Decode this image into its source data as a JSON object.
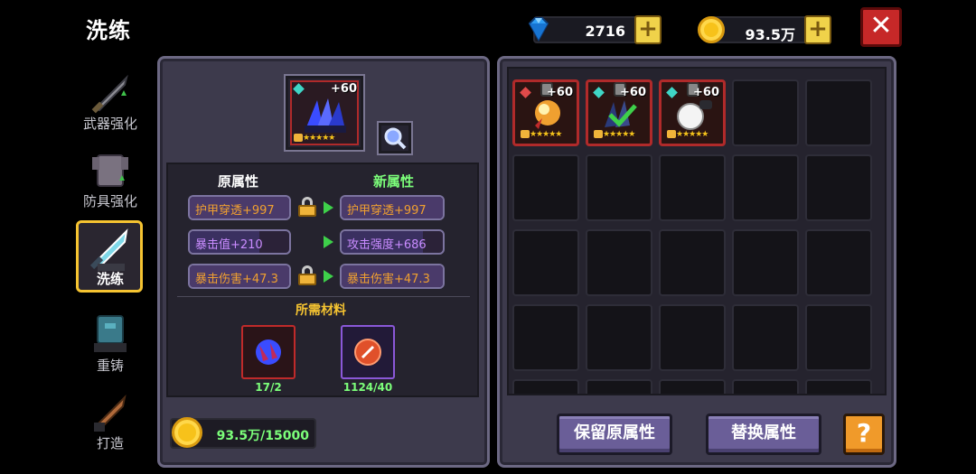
{
  "title": "洗练",
  "currencies": {
    "gems": "2716",
    "coins": "93.5万"
  },
  "nav": [
    {
      "label": "武器强化",
      "icon": "sword-upgrade-icon"
    },
    {
      "label": "防具强化",
      "icon": "armor-upgrade-icon"
    },
    {
      "label": "洗练",
      "icon": "refine-icon",
      "active": true
    },
    {
      "label": "重铸",
      "icon": "recast-icon"
    },
    {
      "label": "打造",
      "icon": "forge-icon"
    }
  ],
  "item": {
    "level": "+60",
    "stars": "★★★★★"
  },
  "attributes": {
    "original_title": "原属性",
    "new_title": "新属性",
    "rows": [
      {
        "old": "护甲穿透+997",
        "new": "护甲穿透+997",
        "locked": true
      },
      {
        "old": "暴击值+210",
        "new": "攻击强度+686",
        "locked": false
      },
      {
        "old": "暴击伤害+47.3",
        "new": "暴击伤害+47.3",
        "locked": true
      }
    ]
  },
  "materials": {
    "title": "所需材料",
    "items": [
      {
        "count": "17/2",
        "icon": "blue-claw-material-icon"
      },
      {
        "count": "1124/40",
        "icon": "red-stone-material-icon"
      }
    ]
  },
  "gold_cost": "93.5万/15000",
  "inventory": {
    "items": [
      {
        "level": "+60",
        "stars": "★★★★★",
        "icon": "golden-fist-icon"
      },
      {
        "level": "+60",
        "stars": "★★★★★",
        "icon": "dark-claw-icon"
      },
      {
        "level": "+60",
        "stars": "★★★★★",
        "icon": "white-orb-icon"
      }
    ]
  },
  "buttons": {
    "keep": "保留原属性",
    "replace": "替换属性",
    "help": "?",
    "close": "✕",
    "plus": "+"
  },
  "colors": {
    "accent_gold": "#f6c431",
    "green_text": "#7cff7a",
    "orange_attr": "#f0a030",
    "purple_attr": "#c98cff"
  }
}
